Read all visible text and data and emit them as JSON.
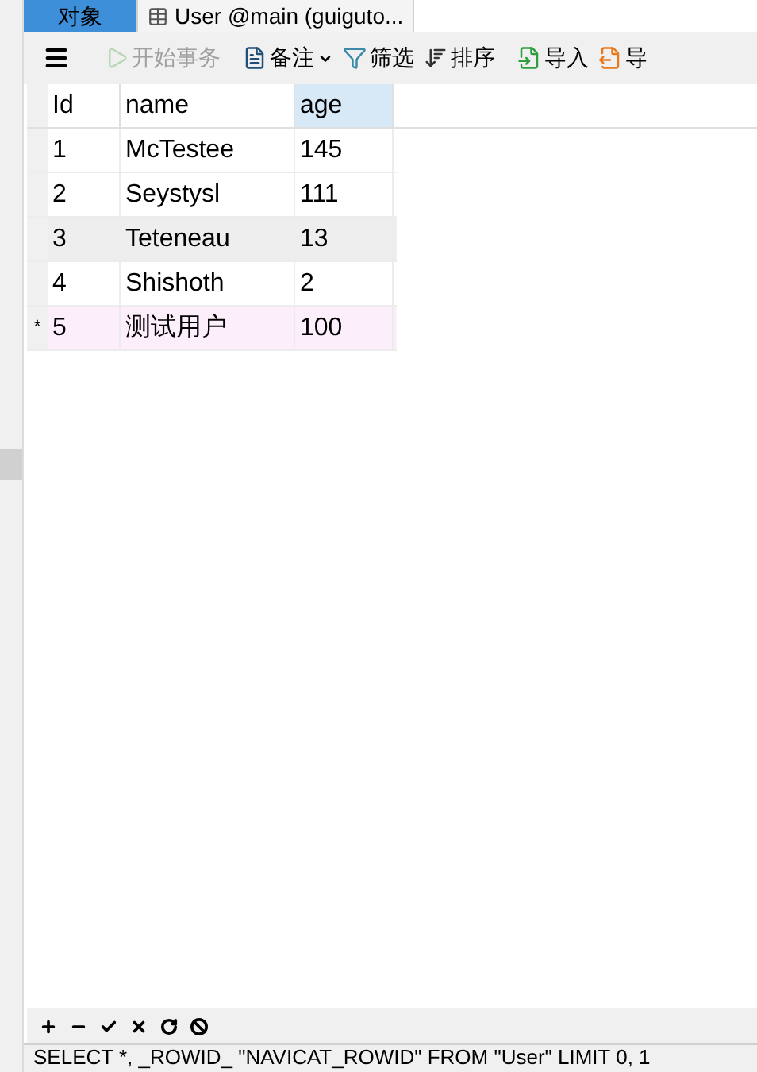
{
  "tabs": [
    {
      "label": "对象",
      "selected": true,
      "kind": "plain"
    },
    {
      "label": "User @main (guiguto...",
      "selected": false,
      "kind": "table"
    }
  ],
  "toolbar": [
    {
      "label": "开始事务",
      "disabled": true,
      "dropdown": false
    },
    {
      "label": "备注",
      "disabled": false,
      "dropdown": true
    },
    {
      "label": "筛选",
      "disabled": false,
      "dropdown": false
    },
    {
      "label": "排序",
      "disabled": false,
      "dropdown": false
    },
    {
      "label": "导入",
      "disabled": false,
      "dropdown": false
    },
    {
      "label": "导",
      "disabled": false,
      "dropdown": false
    }
  ],
  "table": {
    "columns": [
      {
        "label": "Id",
        "selected": false
      },
      {
        "label": "name",
        "selected": false
      },
      {
        "label": "age",
        "selected": true
      }
    ],
    "rows": [
      {
        "cells": [
          "1",
          "McTestee",
          "145"
        ],
        "selected": false,
        "shaded": false
      },
      {
        "cells": [
          "2",
          "Seystysl",
          "111"
        ],
        "selected": false,
        "shaded": false
      },
      {
        "cells": [
          "3",
          "Teteneau",
          "13"
        ],
        "selected": false,
        "shaded": true
      },
      {
        "cells": [
          "4",
          "Shishoth",
          "2"
        ],
        "selected": false,
        "shaded": false
      },
      {
        "cells": [
          "5",
          "测试用户",
          "100"
        ],
        "selected": true,
        "shaded": false,
        "marker": "*"
      }
    ]
  },
  "status_bar": "SELECT *, _ROWID_ \"NAVICAT_ROWID\" FROM \"User\" LIMIT 0, 1"
}
